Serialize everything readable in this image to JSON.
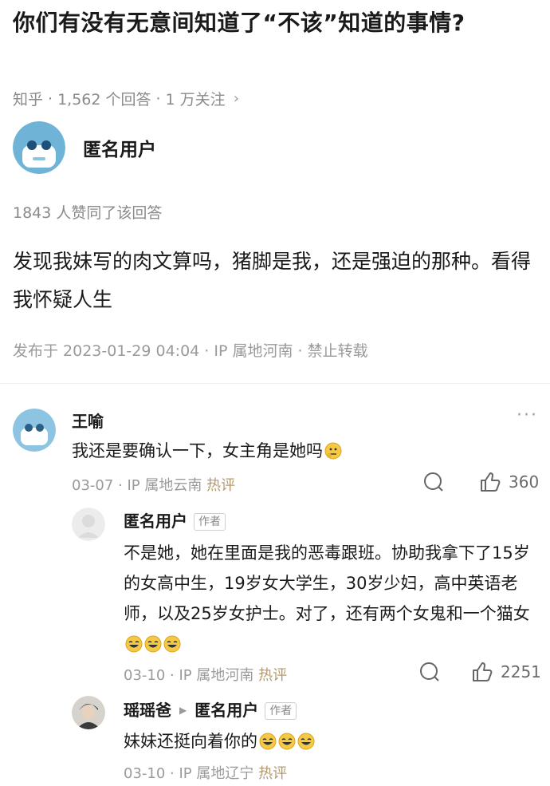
{
  "question": {
    "title": "你们有没有无意间知道了“不该”知道的事情?",
    "source": "知乎",
    "answers": "1,562 个回答",
    "follows": "1 万关注"
  },
  "answer": {
    "author": "匿名用户",
    "votes": "1843 人赞同了该回答",
    "body": "发现我妹写的肉文算吗，猪脚是我，还是强迫的那种。看得我怀疑人生",
    "meta": "发布于 2023-01-29 04:04 · IP 属地河南 · 禁止转载"
  },
  "comments": [
    {
      "name": "王喻",
      "text": "我还是要确认一下，女主角是她吗",
      "date": "03-07 · IP 属地云南",
      "hot": "热评",
      "likes": "360",
      "emoji": "thinking-emoji"
    },
    {
      "name": "匿名用户",
      "badge": "作者",
      "text": "不是她，她在里面是我的恶毒跟班。协助我拿下了15岁的女高中生，19岁女大学生，30岁少妇，高中英语老师，以及25岁女护士。对了，还有两个女鬼和一个猫女",
      "date": "03-10 · IP 属地河南",
      "hot": "热评",
      "likes": "2251",
      "emoji": "laughing-emoji"
    },
    {
      "name": "瑶瑶爸",
      "reply_to": "匿名用户",
      "badge": "作者",
      "text": "妹妹还挺向着你的",
      "date": "03-10 · IP 属地辽宁",
      "hot": "热评",
      "emoji": "laughing-emoji"
    }
  ],
  "colors": {
    "meta_gray": "#8a8a8a",
    "hot_label": "#b29a70",
    "text": "#1a1a1a"
  }
}
